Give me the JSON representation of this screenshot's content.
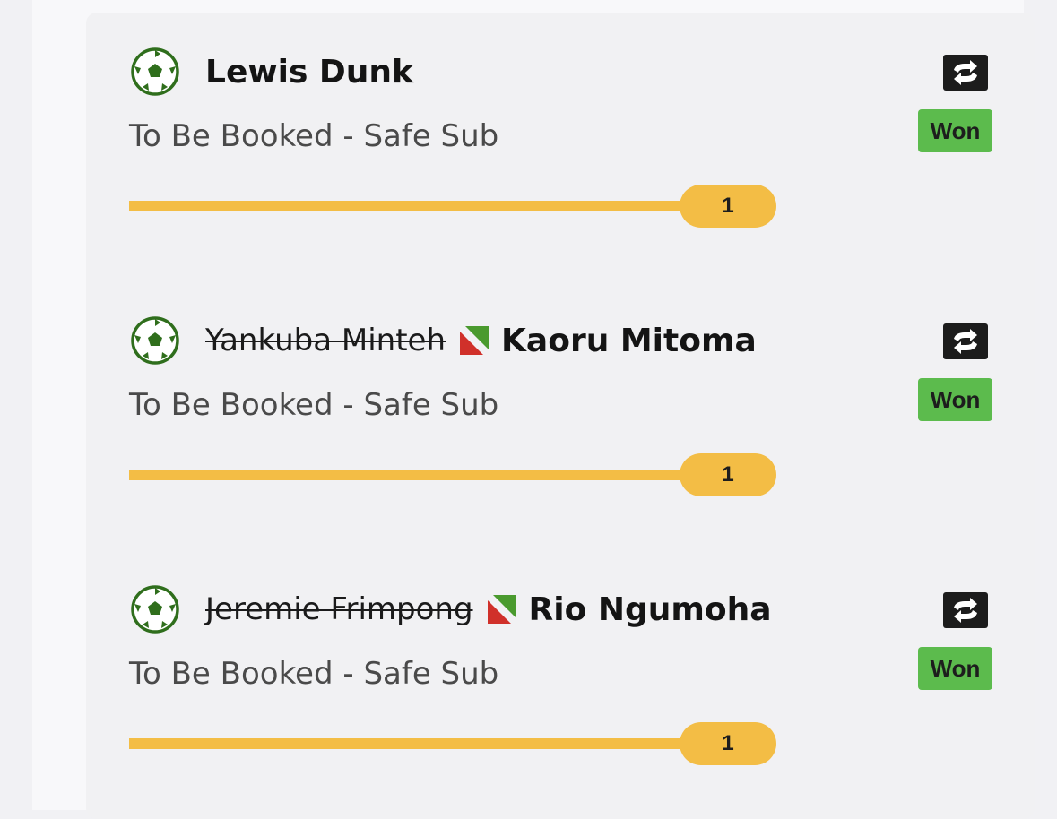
{
  "colors": {
    "page_background": "#f1f1f4",
    "card_background": "#f1f1f3",
    "ball_icon": "#2f6e1c",
    "won_badge": "#5cbb4d",
    "progress": "#f3bd45",
    "sub_icon_red": "#d0302a",
    "sub_icon_green": "#4a9a2e",
    "swap_button": "#1c1c1c"
  },
  "selections": [
    {
      "sport_icon": "soccer-ball-icon",
      "replaced_player": "",
      "player": "Lewis Dunk",
      "market": "To Be Booked - Safe Sub",
      "status": "Won",
      "progress_label": "1",
      "progress_fraction": 1,
      "swap_icon": "swap-arrows-icon"
    },
    {
      "sport_icon": "soccer-ball-icon",
      "replaced_player": "Yankuba Minteh",
      "substitution_icon": "substitution-icon",
      "player": "Kaoru Mitoma",
      "market": "To Be Booked - Safe Sub",
      "status": "Won",
      "progress_label": "1",
      "progress_fraction": 1,
      "swap_icon": "swap-arrows-icon"
    },
    {
      "sport_icon": "soccer-ball-icon",
      "replaced_player": "Jeremie Frimpong",
      "substitution_icon": "substitution-icon",
      "player": "Rio Ngumoha",
      "market": "To Be Booked - Safe Sub",
      "status": "Won",
      "progress_label": "1",
      "progress_fraction": 1,
      "swap_icon": "swap-arrows-icon"
    }
  ]
}
